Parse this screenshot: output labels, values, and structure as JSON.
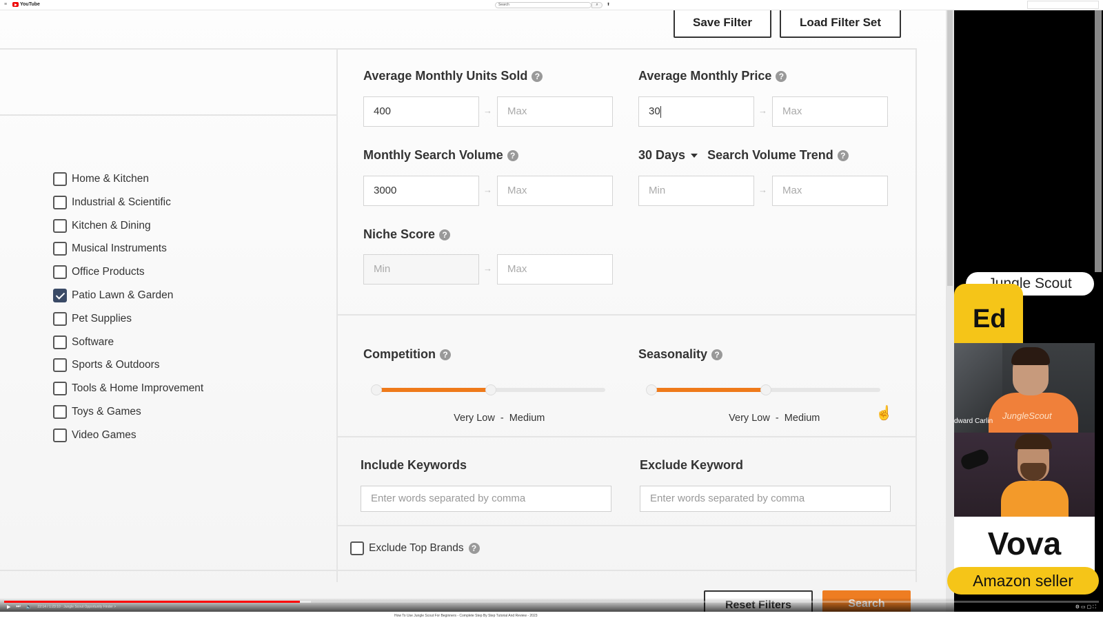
{
  "youtube": {
    "menu_glyph": "≡",
    "logo_text": "YouTube",
    "search_placeholder": "Search",
    "search_glyph": "⌕",
    "mic_glyph": "⬆"
  },
  "toolbar": {
    "save_filter": "Save Filter",
    "load_filter_set": "Load Filter Set"
  },
  "categories": [
    {
      "label": "Home & Kitchen",
      "checked": false
    },
    {
      "label": "Industrial & Scientific",
      "checked": false
    },
    {
      "label": "Kitchen & Dining",
      "checked": false
    },
    {
      "label": "Musical Instruments",
      "checked": false
    },
    {
      "label": "Office Products",
      "checked": false
    },
    {
      "label": "Patio Lawn & Garden",
      "checked": true
    },
    {
      "label": "Pet Supplies",
      "checked": false
    },
    {
      "label": "Software",
      "checked": false
    },
    {
      "label": "Sports & Outdoors",
      "checked": false
    },
    {
      "label": "Tools & Home Improvement",
      "checked": false
    },
    {
      "label": "Toys & Games",
      "checked": false
    },
    {
      "label": "Video Games",
      "checked": false
    }
  ],
  "filters": {
    "units_sold": {
      "label": "Average Monthly Units Sold",
      "min_value": "400",
      "max_placeholder": "Max"
    },
    "price": {
      "label": "Average Monthly Price",
      "min_value": "30",
      "max_placeholder": "Max"
    },
    "search_volume": {
      "label": "Monthly Search Volume",
      "min_value": "3000",
      "max_placeholder": "Max"
    },
    "trend": {
      "period": "30 Days",
      "label": "Search Volume Trend",
      "min_placeholder": "Min",
      "max_placeholder": "Max"
    },
    "niche_score": {
      "label": "Niche Score",
      "min_placeholder": "Min",
      "max_placeholder": "Max"
    },
    "arrow": "→",
    "help": "?"
  },
  "sliders": {
    "competition": {
      "label": "Competition",
      "low": "Very Low",
      "sep": "-",
      "high": "Medium",
      "range": [
        0,
        0.5
      ]
    },
    "seasonality": {
      "label": "Seasonality",
      "low": "Very Low",
      "sep": "-",
      "high": "Medium",
      "range": [
        0,
        0.5
      ]
    }
  },
  "keywords": {
    "include_label": "Include Keywords",
    "include_placeholder": "Enter words separated by comma",
    "exclude_label": "Exclude Keyword",
    "exclude_placeholder": "Enter words separated by comma"
  },
  "exclude_top_brands": {
    "label": "Exclude Top Brands",
    "checked": false
  },
  "actions": {
    "reset": "Reset Filters",
    "search": "Search"
  },
  "overlay": {
    "brand": "Jungle Scout",
    "host_tag": "Ed",
    "host_nameplate": "dward Carlin",
    "host_shirt": "JungleScout",
    "guest_name": "Vova",
    "guest_role": "Amazon seller"
  },
  "player": {
    "progress": 0.27,
    "buffered": 0.28,
    "time_text": "22:14 / 1:23:10 · Jungle Scout Opportunity Finder >",
    "play_glyph": "▶",
    "next_glyph": "⏭",
    "volume_glyph": "🔈",
    "right_glyphs": "⚙ ▭ ▢ ⛶"
  },
  "video_caption": "How To Use Jungle Scout For Beginners - Complete Step By Step Tutorial And Review - 2023",
  "cursor_glyph": "☝"
}
